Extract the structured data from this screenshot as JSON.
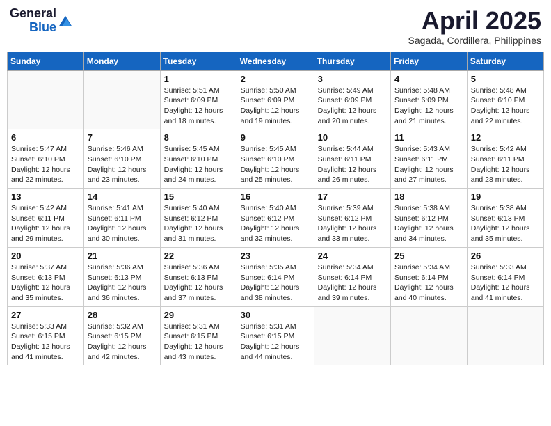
{
  "logo": {
    "text_general": "General",
    "text_blue": "Blue"
  },
  "header": {
    "month": "April 2025",
    "location": "Sagada, Cordillera, Philippines"
  },
  "weekdays": [
    "Sunday",
    "Monday",
    "Tuesday",
    "Wednesday",
    "Thursday",
    "Friday",
    "Saturday"
  ],
  "days": [
    {
      "num": "",
      "sunrise": "",
      "sunset": "",
      "daylight": ""
    },
    {
      "num": "",
      "sunrise": "",
      "sunset": "",
      "daylight": ""
    },
    {
      "num": "1",
      "sunrise": "Sunrise: 5:51 AM",
      "sunset": "Sunset: 6:09 PM",
      "daylight": "Daylight: 12 hours and 18 minutes."
    },
    {
      "num": "2",
      "sunrise": "Sunrise: 5:50 AM",
      "sunset": "Sunset: 6:09 PM",
      "daylight": "Daylight: 12 hours and 19 minutes."
    },
    {
      "num": "3",
      "sunrise": "Sunrise: 5:49 AM",
      "sunset": "Sunset: 6:09 PM",
      "daylight": "Daylight: 12 hours and 20 minutes."
    },
    {
      "num": "4",
      "sunrise": "Sunrise: 5:48 AM",
      "sunset": "Sunset: 6:09 PM",
      "daylight": "Daylight: 12 hours and 21 minutes."
    },
    {
      "num": "5",
      "sunrise": "Sunrise: 5:48 AM",
      "sunset": "Sunset: 6:10 PM",
      "daylight": "Daylight: 12 hours and 22 minutes."
    },
    {
      "num": "6",
      "sunrise": "Sunrise: 5:47 AM",
      "sunset": "Sunset: 6:10 PM",
      "daylight": "Daylight: 12 hours and 22 minutes."
    },
    {
      "num": "7",
      "sunrise": "Sunrise: 5:46 AM",
      "sunset": "Sunset: 6:10 PM",
      "daylight": "Daylight: 12 hours and 23 minutes."
    },
    {
      "num": "8",
      "sunrise": "Sunrise: 5:45 AM",
      "sunset": "Sunset: 6:10 PM",
      "daylight": "Daylight: 12 hours and 24 minutes."
    },
    {
      "num": "9",
      "sunrise": "Sunrise: 5:45 AM",
      "sunset": "Sunset: 6:10 PM",
      "daylight": "Daylight: 12 hours and 25 minutes."
    },
    {
      "num": "10",
      "sunrise": "Sunrise: 5:44 AM",
      "sunset": "Sunset: 6:11 PM",
      "daylight": "Daylight: 12 hours and 26 minutes."
    },
    {
      "num": "11",
      "sunrise": "Sunrise: 5:43 AM",
      "sunset": "Sunset: 6:11 PM",
      "daylight": "Daylight: 12 hours and 27 minutes."
    },
    {
      "num": "12",
      "sunrise": "Sunrise: 5:42 AM",
      "sunset": "Sunset: 6:11 PM",
      "daylight": "Daylight: 12 hours and 28 minutes."
    },
    {
      "num": "13",
      "sunrise": "Sunrise: 5:42 AM",
      "sunset": "Sunset: 6:11 PM",
      "daylight": "Daylight: 12 hours and 29 minutes."
    },
    {
      "num": "14",
      "sunrise": "Sunrise: 5:41 AM",
      "sunset": "Sunset: 6:11 PM",
      "daylight": "Daylight: 12 hours and 30 minutes."
    },
    {
      "num": "15",
      "sunrise": "Sunrise: 5:40 AM",
      "sunset": "Sunset: 6:12 PM",
      "daylight": "Daylight: 12 hours and 31 minutes."
    },
    {
      "num": "16",
      "sunrise": "Sunrise: 5:40 AM",
      "sunset": "Sunset: 6:12 PM",
      "daylight": "Daylight: 12 hours and 32 minutes."
    },
    {
      "num": "17",
      "sunrise": "Sunrise: 5:39 AM",
      "sunset": "Sunset: 6:12 PM",
      "daylight": "Daylight: 12 hours and 33 minutes."
    },
    {
      "num": "18",
      "sunrise": "Sunrise: 5:38 AM",
      "sunset": "Sunset: 6:12 PM",
      "daylight": "Daylight: 12 hours and 34 minutes."
    },
    {
      "num": "19",
      "sunrise": "Sunrise: 5:38 AM",
      "sunset": "Sunset: 6:13 PM",
      "daylight": "Daylight: 12 hours and 35 minutes."
    },
    {
      "num": "20",
      "sunrise": "Sunrise: 5:37 AM",
      "sunset": "Sunset: 6:13 PM",
      "daylight": "Daylight: 12 hours and 35 minutes."
    },
    {
      "num": "21",
      "sunrise": "Sunrise: 5:36 AM",
      "sunset": "Sunset: 6:13 PM",
      "daylight": "Daylight: 12 hours and 36 minutes."
    },
    {
      "num": "22",
      "sunrise": "Sunrise: 5:36 AM",
      "sunset": "Sunset: 6:13 PM",
      "daylight": "Daylight: 12 hours and 37 minutes."
    },
    {
      "num": "23",
      "sunrise": "Sunrise: 5:35 AM",
      "sunset": "Sunset: 6:14 PM",
      "daylight": "Daylight: 12 hours and 38 minutes."
    },
    {
      "num": "24",
      "sunrise": "Sunrise: 5:34 AM",
      "sunset": "Sunset: 6:14 PM",
      "daylight": "Daylight: 12 hours and 39 minutes."
    },
    {
      "num": "25",
      "sunrise": "Sunrise: 5:34 AM",
      "sunset": "Sunset: 6:14 PM",
      "daylight": "Daylight: 12 hours and 40 minutes."
    },
    {
      "num": "26",
      "sunrise": "Sunrise: 5:33 AM",
      "sunset": "Sunset: 6:14 PM",
      "daylight": "Daylight: 12 hours and 41 minutes."
    },
    {
      "num": "27",
      "sunrise": "Sunrise: 5:33 AM",
      "sunset": "Sunset: 6:15 PM",
      "daylight": "Daylight: 12 hours and 41 minutes."
    },
    {
      "num": "28",
      "sunrise": "Sunrise: 5:32 AM",
      "sunset": "Sunset: 6:15 PM",
      "daylight": "Daylight: 12 hours and 42 minutes."
    },
    {
      "num": "29",
      "sunrise": "Sunrise: 5:31 AM",
      "sunset": "Sunset: 6:15 PM",
      "daylight": "Daylight: 12 hours and 43 minutes."
    },
    {
      "num": "30",
      "sunrise": "Sunrise: 5:31 AM",
      "sunset": "Sunset: 6:15 PM",
      "daylight": "Daylight: 12 hours and 44 minutes."
    },
    {
      "num": "",
      "sunrise": "",
      "sunset": "",
      "daylight": ""
    },
    {
      "num": "",
      "sunrise": "",
      "sunset": "",
      "daylight": ""
    }
  ]
}
